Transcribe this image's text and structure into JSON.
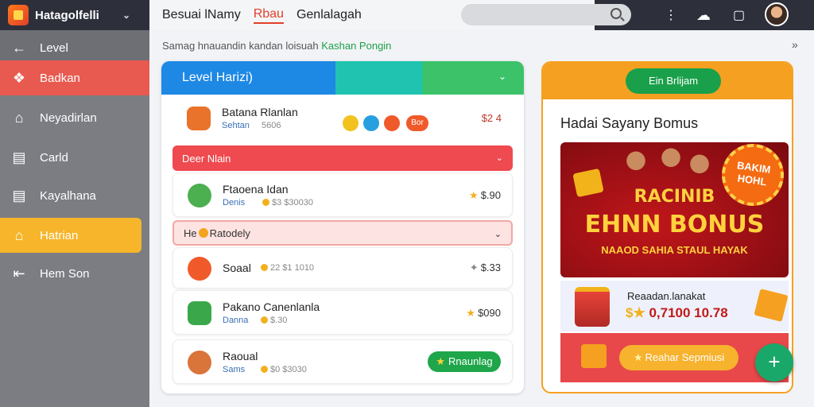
{
  "app": {
    "title": "Hatagolfelli"
  },
  "topnav": {
    "tabs": [
      "Besuai lNamy",
      "Rbau",
      "Genlalagah"
    ]
  },
  "search": {
    "placeholder": ""
  },
  "sidebar": {
    "items": [
      {
        "label": "Level",
        "icon": "arrow-left-icon"
      },
      {
        "label": "Badkan",
        "icon": "puzzle-icon"
      },
      {
        "label": "Neyadirlan",
        "icon": "home-icon"
      },
      {
        "label": "Carld",
        "icon": "chart-icon"
      },
      {
        "label": "Kayalhana",
        "icon": "id-card-icon"
      },
      {
        "label": "Hatrian",
        "icon": "house-icon"
      },
      {
        "label": "Hem Son",
        "icon": "exit-icon"
      }
    ]
  },
  "subhead": {
    "text": "Samag hnauandin kandan loisuah",
    "highlight": "Kashan Pongin"
  },
  "panel": {
    "title": "Level Harizi)",
    "top_row": {
      "name": "Batana Rlanlan",
      "sub": "Sehtan",
      "value": "5606",
      "chip": "Bor",
      "price": "$2 4"
    },
    "section1": {
      "label": "Deer Nlain"
    },
    "row1": {
      "name": "Ftaoena Idan",
      "sub": "Denis",
      "value": "$3 $30030",
      "price": "$.90"
    },
    "section2": {
      "label": "He",
      "label2": "Ratodely"
    },
    "row2": {
      "name": "Soaal",
      "sub": "",
      "value": "22 $1 1010",
      "price": "$.33"
    },
    "row3": {
      "name": "Pakano Canenlanla",
      "sub": "Danna",
      "value": "$.30",
      "price": "$090"
    },
    "row4": {
      "name": "Raoual",
      "sub": "Sams",
      "value": "$0 $3030",
      "button": "Rnaunlag"
    }
  },
  "card": {
    "claim": "Ein Brlijam",
    "title": "Hadai Sayany Bomus",
    "banner": {
      "burst": "BAKIM HOHL",
      "line1": "RACINIB",
      "line2": "EHNN BONUS",
      "line3": "NAAOD SAHIA STAUL HAYAK"
    },
    "promo": {
      "line1": "Reaadan.lanakat",
      "line2": "0,7100 10.78"
    },
    "cta": "Reahar Sepmiusi"
  }
}
